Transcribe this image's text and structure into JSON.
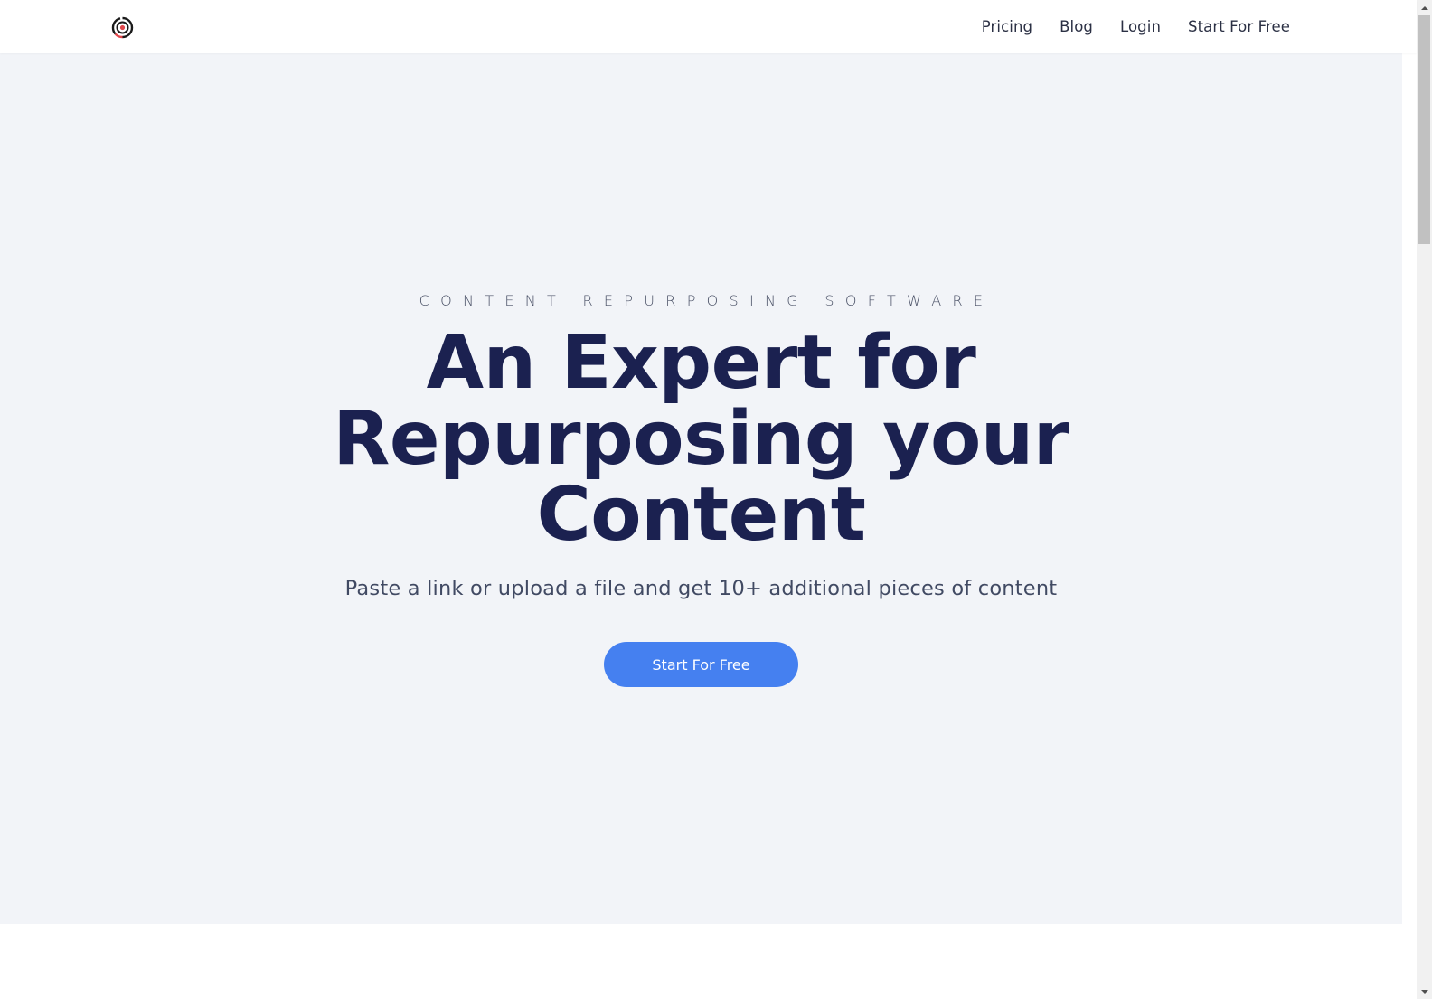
{
  "navbar": {
    "logo_icon": "target-logo-icon",
    "links": [
      {
        "label": "Pricing"
      },
      {
        "label": "Blog"
      },
      {
        "label": "Login"
      },
      {
        "label": "Start For Free"
      }
    ]
  },
  "hero": {
    "eyebrow": "CONTENT REPURPOSING SOFTWARE",
    "headline_lines": [
      "An Expert for",
      "Repurposing your",
      "Content"
    ],
    "subtitle": "Paste a link or upload a file and get 10+ additional pieces of content",
    "cta_label": "Start For Free"
  },
  "colors": {
    "headline": "#1b2150",
    "accent": "#4580f0",
    "hero_background": "#f2f4f8",
    "logo_red": "#e0474c"
  }
}
